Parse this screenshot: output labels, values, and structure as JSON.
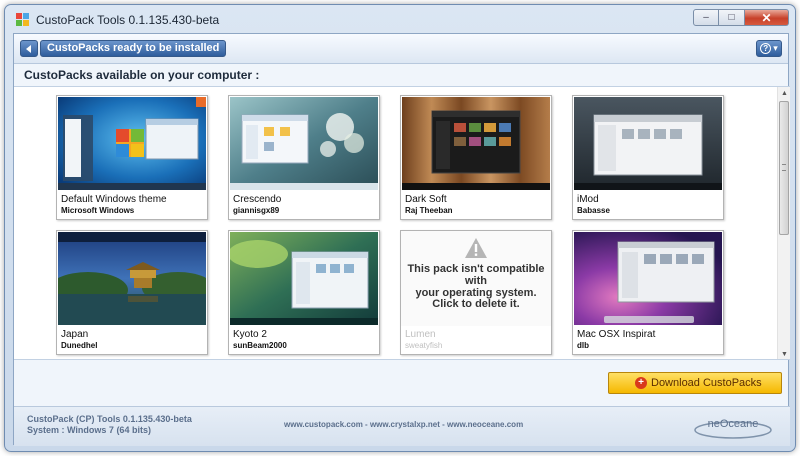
{
  "window": {
    "title": "CustoPack Tools 0.1.135.430-beta",
    "controls": {
      "minimize": "‒",
      "maximize": "□",
      "close": "✕"
    }
  },
  "nav": {
    "breadcrumb": "CustoPacks ready to be installed",
    "help_label": "?",
    "help_arrow": "▾"
  },
  "section_title": "CustoPacks available on your computer :",
  "packs": [
    {
      "name": "Default Windows theme",
      "author": "Microsoft Windows",
      "thumb": "win7",
      "compatible": true
    },
    {
      "name": "Crescendo",
      "author": "giannisgx89",
      "thumb": "crescendo",
      "compatible": true
    },
    {
      "name": "Dark Soft",
      "author": "Raj Theeban",
      "thumb": "darksoft",
      "compatible": true
    },
    {
      "name": "iMod",
      "author": "Babasse",
      "thumb": "imod",
      "compatible": true
    },
    {
      "name": "Japan",
      "author": "Dunedhel",
      "thumb": "japan",
      "compatible": true
    },
    {
      "name": "Kyoto 2",
      "author": "sunBeam2000",
      "thumb": "kyoto",
      "compatible": true
    },
    {
      "name": "Lumen",
      "author": "sweatyfish",
      "thumb": "none",
      "compatible": false
    },
    {
      "name": "Mac OSX Inspirat",
      "author": "dlb",
      "thumb": "mac",
      "compatible": true
    }
  ],
  "incompatible": {
    "line1": "This pack isn't compatible with",
    "line2": "your operating system.",
    "line3": "Click to delete it."
  },
  "download_button": "Download CustoPacks",
  "footer": {
    "version": "CustoPack (CP) Tools 0.1.135.430-beta",
    "system": "System : Windows 7  (64 bits)",
    "links": "www.custopack.com - www.crystalxp.net - www.neoceane.com",
    "logo_text": "neOceane"
  },
  "colors": {
    "accent_blue": "#2f5d9c",
    "download_yellow": "#f5b800",
    "window_frame": "#c9d8ea"
  }
}
